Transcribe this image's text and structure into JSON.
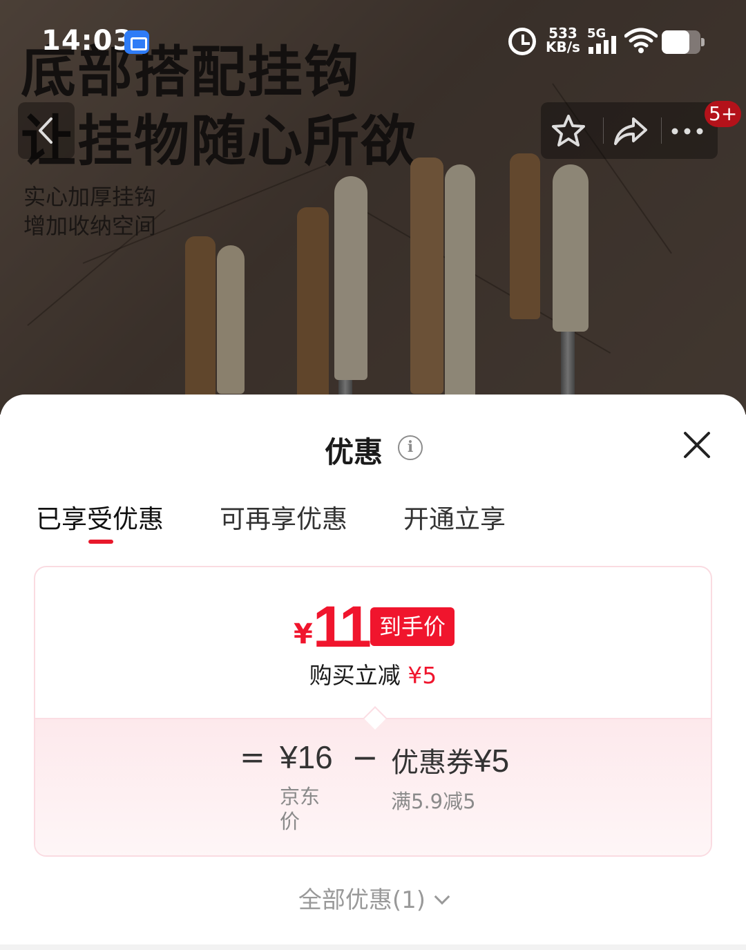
{
  "status_bar": {
    "time": "14:03",
    "speed_value": "533",
    "speed_unit": "KB/s",
    "network": "5G",
    "icons": [
      "screen-capture-app-icon",
      "alarm-icon",
      "signal-icon",
      "wifi-icon",
      "battery-icon"
    ]
  },
  "hero": {
    "title_line1": "底部搭配挂钩",
    "title_line2": "让挂物随心所欲",
    "sub_line1": "实心加厚挂钩",
    "sub_line2": "增加收纳空间"
  },
  "nav": {
    "back_icon": "chevron-left-icon",
    "actions": [
      "star-icon",
      "share-icon",
      "more-icon"
    ],
    "badge": "5+"
  },
  "sheet": {
    "title": "优惠",
    "info_symbol": "i",
    "tabs": [
      {
        "label": "已享受优惠",
        "active": true
      },
      {
        "label": "可再享优惠",
        "active": false
      },
      {
        "label": "开通立享",
        "active": false
      }
    ],
    "card": {
      "currency": "¥",
      "final_price": "11",
      "final_price_tag": "到手价",
      "reduce_text": "购买立减",
      "reduce_amount": "¥5",
      "equals": "=",
      "jd_price": "¥16",
      "jd_price_label": "京东价",
      "minus": "−",
      "coupon_label": "优惠券",
      "coupon_amount": "¥5",
      "coupon_rule": "满5.9减5"
    },
    "all_offers": "全部优惠(1)"
  },
  "colors": {
    "accent_red": "#f0152d",
    "card_border": "#fadbe1",
    "calc_bg": "#fde9ec"
  }
}
